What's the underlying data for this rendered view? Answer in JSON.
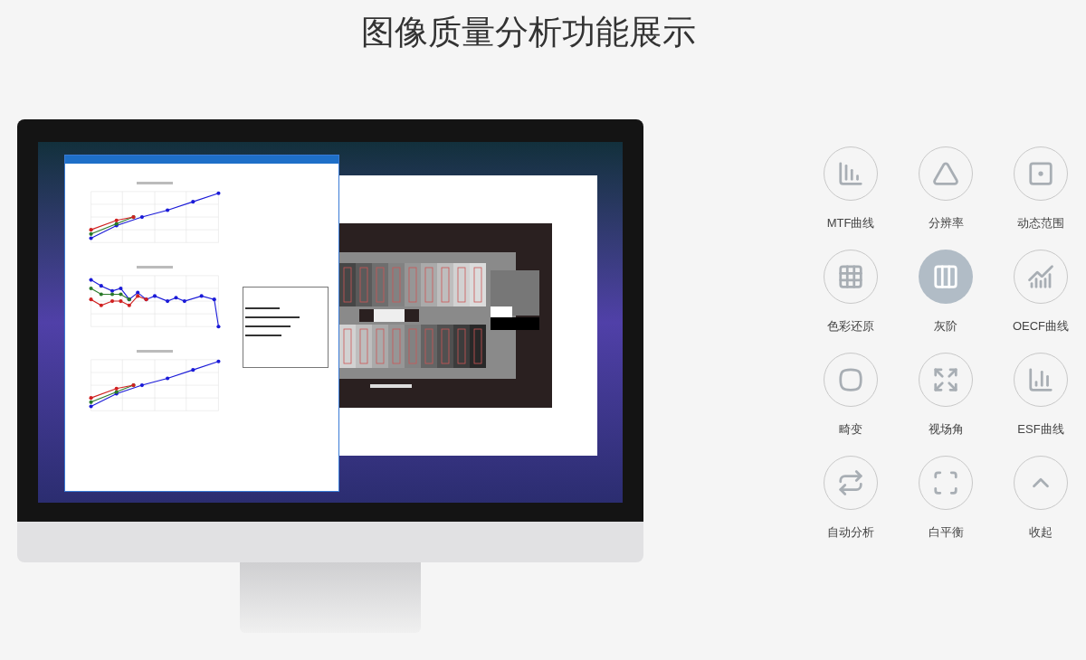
{
  "title": "图像质量分析功能展示",
  "monitor": {
    "analysis_window": {
      "charts": [
        {
          "kind": "rising"
        },
        {
          "kind": "wavy"
        },
        {
          "kind": "rising"
        }
      ]
    }
  },
  "features": [
    {
      "label": "MTF曲线",
      "kind": "mtf",
      "selected": false
    },
    {
      "label": "分辨率",
      "kind": "resolution",
      "selected": false
    },
    {
      "label": "动态范围",
      "kind": "dynamic-range",
      "selected": false
    },
    {
      "label": "色彩还原",
      "kind": "color",
      "selected": false
    },
    {
      "label": "灰阶",
      "kind": "grayscale",
      "selected": true
    },
    {
      "label": "OECF曲线",
      "kind": "oecf",
      "selected": false
    },
    {
      "label": "畸变",
      "kind": "distortion",
      "selected": false
    },
    {
      "label": "视场角",
      "kind": "fov",
      "selected": false
    },
    {
      "label": "ESF曲线",
      "kind": "esf",
      "selected": false
    },
    {
      "label": "自动分析",
      "kind": "auto",
      "selected": false
    },
    {
      "label": "白平衡",
      "kind": "white-balance",
      "selected": false
    },
    {
      "label": "收起",
      "kind": "collapse",
      "selected": false
    }
  ]
}
